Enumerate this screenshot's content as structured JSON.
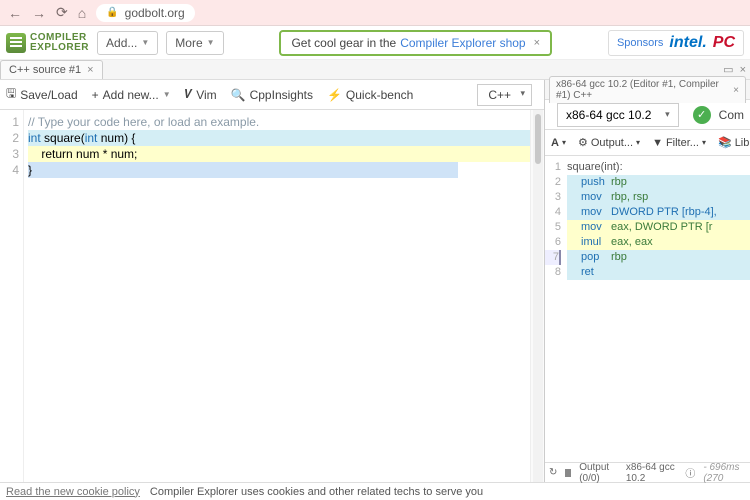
{
  "browser": {
    "url_host": "godbolt.org"
  },
  "logo": {
    "line1": "COMPILER",
    "line2": "EXPLORER"
  },
  "topbar": {
    "add": "Add...",
    "more": "More",
    "banner_pre": "Get cool gear in the ",
    "banner_link": "Compiler Explorer shop",
    "sponsors_label": "Sponsors",
    "sponsor1": "intel.",
    "sponsor2": "PC"
  },
  "source_tab": {
    "label": "C++ source #1"
  },
  "toolbar": {
    "save": "Save/Load",
    "addnew": "Add new...",
    "vim": "Vim",
    "cppinsights": "CppInsights",
    "quickbench": "Quick-bench",
    "lang": "C++"
  },
  "source": {
    "lines": [
      "1",
      "2",
      "3",
      "4"
    ],
    "l1": "// Type your code here, or load an example.",
    "l2a": "int",
    "l2b": " square(",
    "l2c": "int",
    "l2d": " num) {",
    "l3": "    return num * num;",
    "l4": "}"
  },
  "right_tab": {
    "label": "x86-64 gcc 10.2 (Editor #1, Compiler #1) C++"
  },
  "compiler": {
    "name": "x86-64 gcc 10.2",
    "compile_btn": "Com"
  },
  "right_tools": {
    "font": "A",
    "output": "Output...",
    "filter": "Filter...",
    "libs": "Libraries"
  },
  "asm": {
    "lines": [
      "1",
      "2",
      "3",
      "4",
      "5",
      "6",
      "7",
      "8"
    ],
    "l1": "square(int):",
    "m2": "push",
    "o2": "rbp",
    "m3": "mov",
    "o3": "rbp, rsp",
    "m4": "mov",
    "o4": "DWORD PTR [rbp-4],",
    "m5": "mov",
    "o5": "eax, DWORD PTR [r",
    "m6": "imul",
    "o6": "eax, eax",
    "m7": "pop",
    "o7": "rbp",
    "m8": "ret",
    "o8": ""
  },
  "status": {
    "output": "Output (0/0)",
    "compiler": "x86-64 gcc 10.2",
    "time": "- 696ms (270"
  },
  "cookie": {
    "policy": "Read the new cookie policy",
    "msg": "Compiler Explorer uses cookies and other related techs to serve you"
  }
}
